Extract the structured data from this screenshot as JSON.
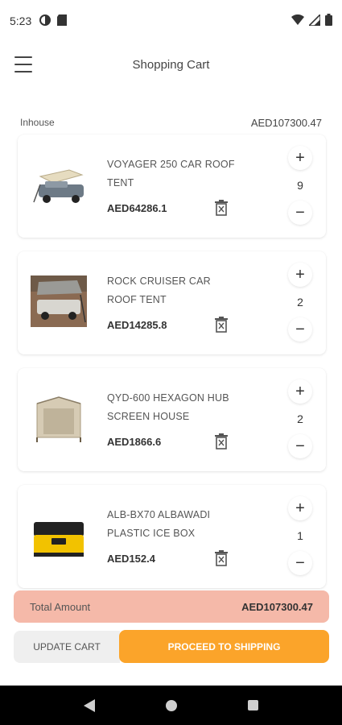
{
  "status_bar": {
    "time": "5:23"
  },
  "app_bar": {
    "title": "Shopping Cart"
  },
  "shop": {
    "name": "Inhouse",
    "total": "AED107300.47"
  },
  "items": [
    {
      "name": "VOYAGER 250 CAR ROOF TENT",
      "price": "AED64286.1",
      "qty": "9"
    },
    {
      "name": "ROCK CRUISER CAR ROOF TENT",
      "price": "AED14285.8",
      "qty": "2"
    },
    {
      "name": "QYD-600 HEXAGON HUB SCREEN HOUSE",
      "price": "AED1866.6",
      "qty": "2"
    },
    {
      "name": "ALB-BX70 ALBAWADI PLASTIC ICE BOX",
      "price": "AED152.4",
      "qty": "1"
    }
  ],
  "controls": {
    "plus": "+",
    "minus": "−"
  },
  "summary": {
    "label": "Total Amount",
    "value": "AED107300.47"
  },
  "actions": {
    "update": "UPDATE CART",
    "proceed": "PROCEED TO SHIPPING"
  },
  "colors": {
    "accent": "#fba42a",
    "total_bar": "#f5b9a9",
    "update_bg": "#efefef"
  }
}
